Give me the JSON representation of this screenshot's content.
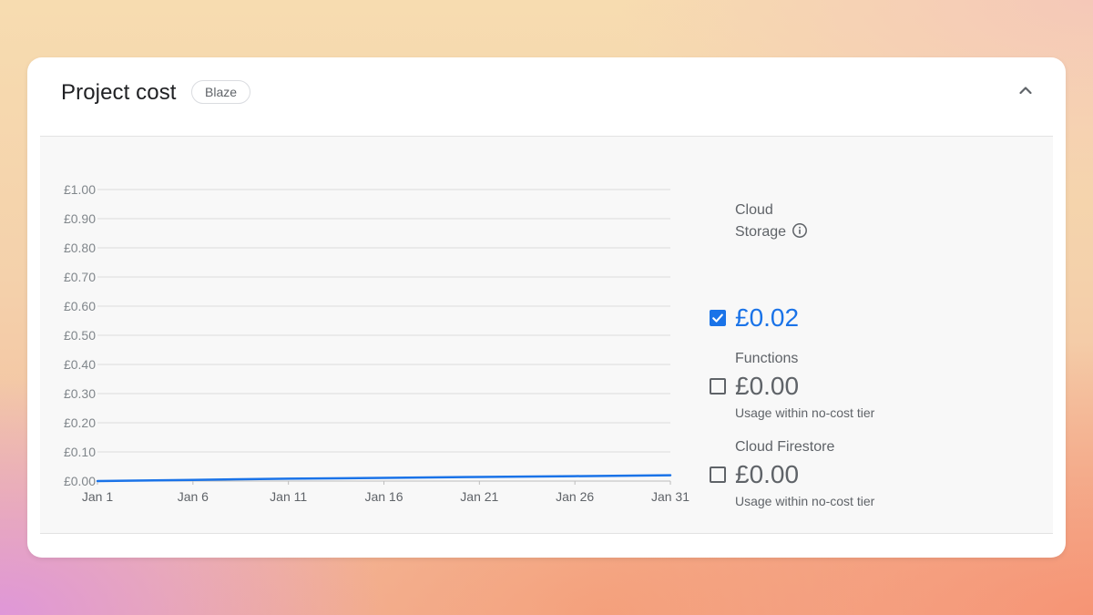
{
  "card": {
    "title": "Project cost",
    "plan_badge": "Blaze",
    "collapse_icon": "chevron-up-icon"
  },
  "chart_data": {
    "type": "line",
    "x": [
      "Jan 1",
      "Jan 6",
      "Jan 11",
      "Jan 16",
      "Jan 21",
      "Jan 26",
      "Jan 31"
    ],
    "x_day": [
      1,
      6,
      11,
      16,
      21,
      26,
      31
    ],
    "y_ticks": [
      "£0.00",
      "£0.10",
      "£0.20",
      "£0.30",
      "£0.40",
      "£0.50",
      "£0.60",
      "£0.70",
      "£0.80",
      "£0.90",
      "£1.00"
    ],
    "ylim": [
      0,
      1
    ],
    "grid": true,
    "series": [
      {
        "color": "#1a73e8",
        "values": [
          0.0,
          0.004,
          0.008,
          0.011,
          0.014,
          0.017,
          0.02
        ]
      }
    ]
  },
  "products": [
    {
      "name_line1": "Cloud",
      "name_line2": "Storage",
      "info_icon": "info-circle-icon",
      "amount": "£0.02",
      "checked": true,
      "note": ""
    },
    {
      "name_line1": "Functions",
      "amount": "£0.00",
      "checked": false,
      "note": "Usage within no-cost tier"
    },
    {
      "name_line1": "Cloud Firestore",
      "amount": "£0.00",
      "checked": false,
      "note": "Usage within no-cost tier"
    }
  ],
  "colors": {
    "accent": "#1a73e8",
    "text_secondary": "#5f6368"
  }
}
